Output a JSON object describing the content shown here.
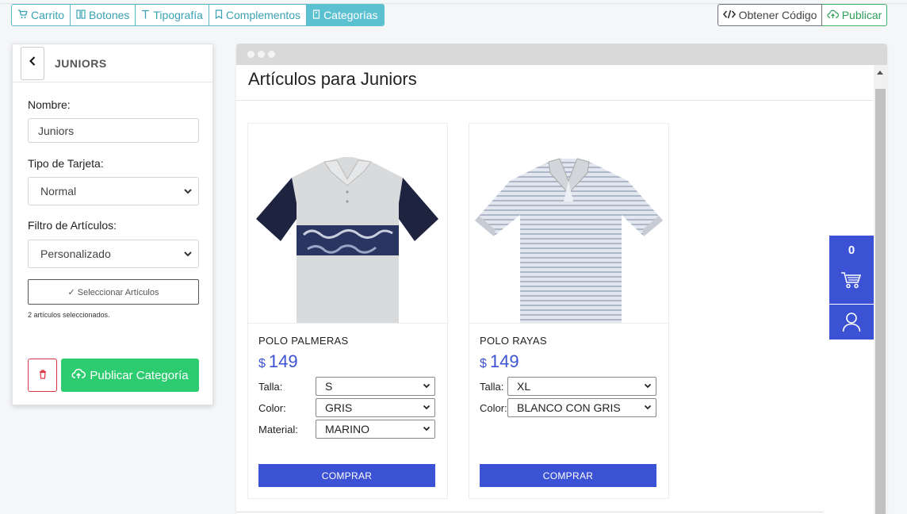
{
  "toolbar": {
    "tabs": [
      {
        "label": "Carrito",
        "icon": "cart-icon"
      },
      {
        "label": "Botones",
        "icon": "buttons-icon"
      },
      {
        "label": "Tipografía",
        "icon": "typography-icon"
      },
      {
        "label": "Complementos",
        "icon": "bookmark-icon"
      },
      {
        "label": "Categorías",
        "icon": "tag-icon",
        "active": true
      }
    ],
    "code_label": "Obtener Código",
    "publish_label": "Publicar"
  },
  "panel": {
    "title": "JUNIORS",
    "name_label": "Nombre:",
    "name_value": "Juniors",
    "card_type_label": "Tipo de Tarjeta:",
    "card_type_value": "Normal",
    "filter_label": "Filtro de Artículos:",
    "filter_value": "Personalizado",
    "select_button": "✓ Seleccionar Artículos",
    "selected_count": "2 artículos seleccionados.",
    "publish_button": "Publicar Categoría"
  },
  "preview": {
    "title": "Artículos para Juniors",
    "products": [
      {
        "name": "POLO PALMERAS",
        "currency": "$",
        "price": "149",
        "options": [
          {
            "label": "Talla:",
            "value": "S"
          },
          {
            "label": "Color:",
            "value": "GRIS"
          },
          {
            "label": "Material:",
            "value": "MARINO"
          }
        ],
        "buy_label": "COMPRAR"
      },
      {
        "name": "POLO RAYAS",
        "currency": "$",
        "price": "149",
        "options": [
          {
            "label": "Talla:",
            "value": "XL"
          },
          {
            "label": "Color:",
            "value": "BLANCO CON GRIS"
          }
        ],
        "buy_label": "COMPRAR"
      }
    ]
  },
  "cart_widget": {
    "count": "0"
  },
  "colors": {
    "accent": "#5bc0cf",
    "brand": "#3b52d4",
    "success": "#2ecc71",
    "danger": "#dc3545"
  }
}
